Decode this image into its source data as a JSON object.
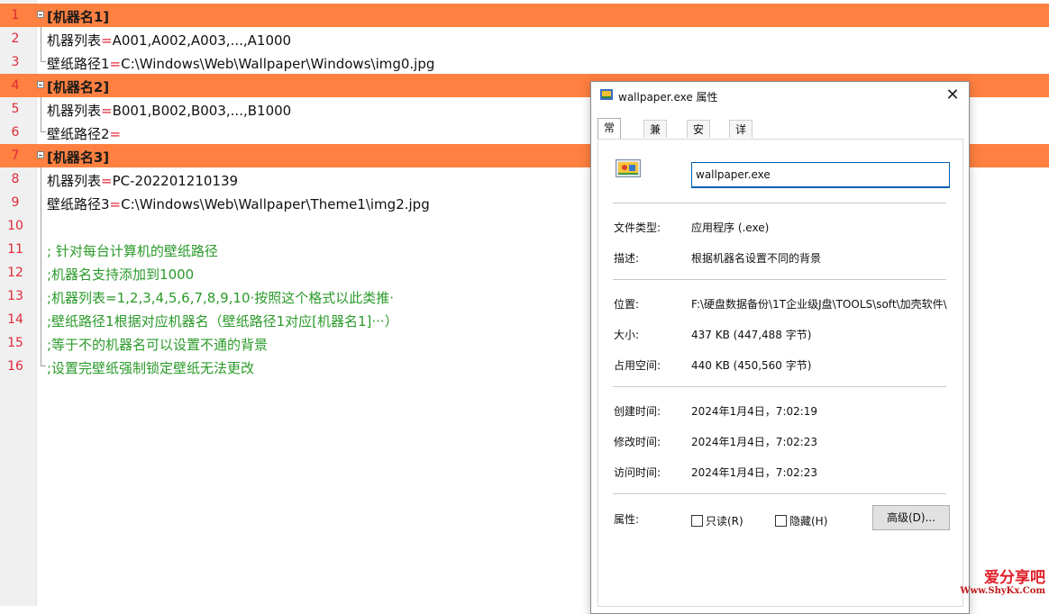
{
  "editor": {
    "lines": [
      {
        "n": "1",
        "section": "[机器名1]"
      },
      {
        "n": "2",
        "key": "机器列表",
        "eq": "=",
        "val": "A001,A002,A003,...,A1000"
      },
      {
        "n": "3",
        "key": "壁纸路径1",
        "eq": "=",
        "val": "C:\\Windows\\Web\\Wallpaper\\Windows\\img0.jpg"
      },
      {
        "n": "4",
        "section": "[机器名2]"
      },
      {
        "n": "5",
        "key": "机器列表",
        "eq": "=",
        "val": "B001,B002,B003,...,B1000"
      },
      {
        "n": "6",
        "key": "壁纸路径2",
        "eq": "=",
        "val": ""
      },
      {
        "n": "7",
        "section": "[机器名3]"
      },
      {
        "n": "8",
        "key": "机器列表",
        "eq": "=",
        "val": "PC-202201210139"
      },
      {
        "n": "9",
        "key": "壁纸路径3",
        "eq": "=",
        "val": "C:\\Windows\\Web\\Wallpaper\\Theme1\\img2.jpg"
      },
      {
        "n": "10"
      },
      {
        "n": "11",
        "comment": "; 针对每台计算机的壁纸路径"
      },
      {
        "n": "12",
        "comment": ";机器名支持添加到1000"
      },
      {
        "n": "13",
        "comment": ";机器列表=1,2,3,4,5,6,7,8,9,10·按照这个格式以此类推·"
      },
      {
        "n": "14",
        "comment": ";壁纸路径1根据对应机器名（壁纸路径1对应[机器名1]···）"
      },
      {
        "n": "15",
        "comment": ";等于不的机器名可以设置不通的背景"
      },
      {
        "n": "16",
        "comment": ";设置完壁纸强制锁定壁纸无法更改"
      }
    ]
  },
  "dialog": {
    "title": "wallpaper.exe 属性",
    "close_glyph": "✕",
    "tabs": [
      "常规",
      "兼容性",
      "安全",
      "详细信息"
    ],
    "file_name": "wallpaper.exe",
    "file_type_label": "文件类型:",
    "file_type_value": "应用程序 (.exe)",
    "desc_label": "描述:",
    "desc_value": "根据机器名设置不同的背景",
    "location_label": "位置:",
    "location_value": "F:\\硬盘数据备份\\1T企业级J盘\\TOOLS\\soft\\加壳软件\\",
    "size_label": "大小:",
    "size_value": "437 KB (447,488 字节)",
    "disk_label": "占用空间:",
    "disk_value": "440 KB (450,560 字节)",
    "created_label": "创建时间:",
    "created_value": "2024年1月4日，7:02:19",
    "modified_label": "修改时间:",
    "modified_value": "2024年1月4日，7:02:23",
    "accessed_label": "访问时间:",
    "accessed_value": "2024年1月4日，7:02:23",
    "attr_label": "属性:",
    "readonly_label": "只读(R)",
    "hidden_label": "隐藏(H)",
    "advanced_label": "高级(D)..."
  },
  "watermark": {
    "text": "爱分享吧",
    "url": "Www.ShyKx.Com"
  },
  "colors": {
    "section_bg": "#ff8040",
    "line_number": "#e0293a",
    "comment": "#2a9a2a",
    "accent": "#0060b0"
  }
}
